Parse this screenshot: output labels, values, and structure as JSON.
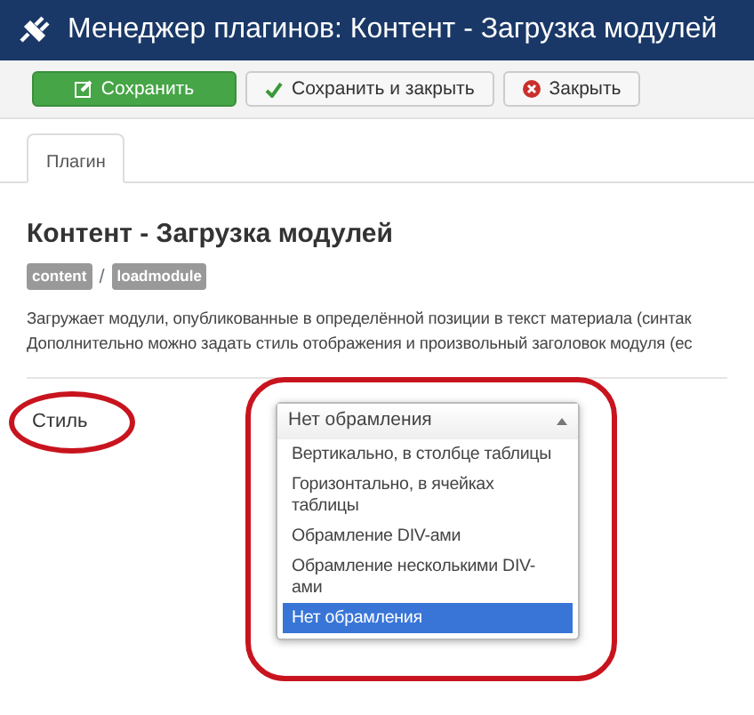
{
  "header": {
    "title": "Менеджер плагинов: Контент - Загрузка модулей"
  },
  "toolbar": [
    {
      "kind": "save",
      "label": "Сохранить"
    },
    {
      "kind": "save-close",
      "label": "Сохранить и закрыть"
    },
    {
      "kind": "close",
      "label": "Закрыть"
    }
  ],
  "tabs": [
    {
      "label": "Плагин",
      "selected": true
    }
  ],
  "plugin": {
    "title": "Контент - Загрузка модулей",
    "tags": [
      "content",
      "loadmodule"
    ],
    "separator": "/",
    "description": [
      "Загружает модули, опубликованные в определённой позиции в текст материала (синтак",
      "Дополнительно можно задать стиль отображения и произвольный заголовок модуля (ес"
    ]
  },
  "field": {
    "label": "Стиль",
    "label_highlighted": true,
    "dropdown_highlighted": true,
    "value": "Нет обрамления",
    "expanded": true,
    "options": [
      {
        "label": "Вертикально, в столбце таблицы",
        "selected": false
      },
      {
        "label": "Горизонтально, в ячейках таблицы",
        "selected": false
      },
      {
        "label": "Обрамление DIV-ами",
        "selected": false
      },
      {
        "label": "Обрамление несколькими DIV-ами",
        "selected": false
      },
      {
        "label": "Нет обрамления",
        "selected": true
      }
    ]
  }
}
